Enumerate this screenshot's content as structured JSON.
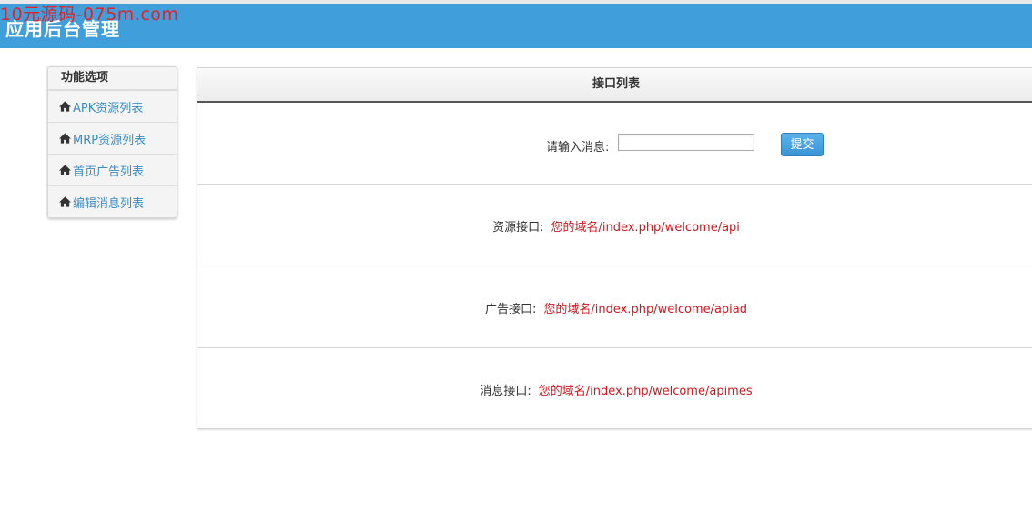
{
  "watermark": "10元源码-075m.com",
  "header": {
    "title": "应用后台管理"
  },
  "sidebar": {
    "title": "功能选项",
    "items": [
      {
        "label": "APK资源列表"
      },
      {
        "label": "MRP资源列表"
      },
      {
        "label": "首页广告列表"
      },
      {
        "label": "编辑消息列表"
      }
    ]
  },
  "panel": {
    "title": "接口列表",
    "form": {
      "label": "请输入消息:",
      "input_value": "",
      "submit_label": "提交"
    },
    "apis": [
      {
        "label": "资源接口:",
        "value": "您的域名/index.php/welcome/api"
      },
      {
        "label": "广告接口:",
        "value": "您的域名/index.php/welcome/apiad"
      },
      {
        "label": "消息接口:",
        "value": "您的域名/index.php/welcome/apimes"
      }
    ]
  },
  "colors": {
    "header": "#409fda",
    "link": "#3a8cc4",
    "api_value": "#d0181e",
    "button": "#3a95d4"
  }
}
